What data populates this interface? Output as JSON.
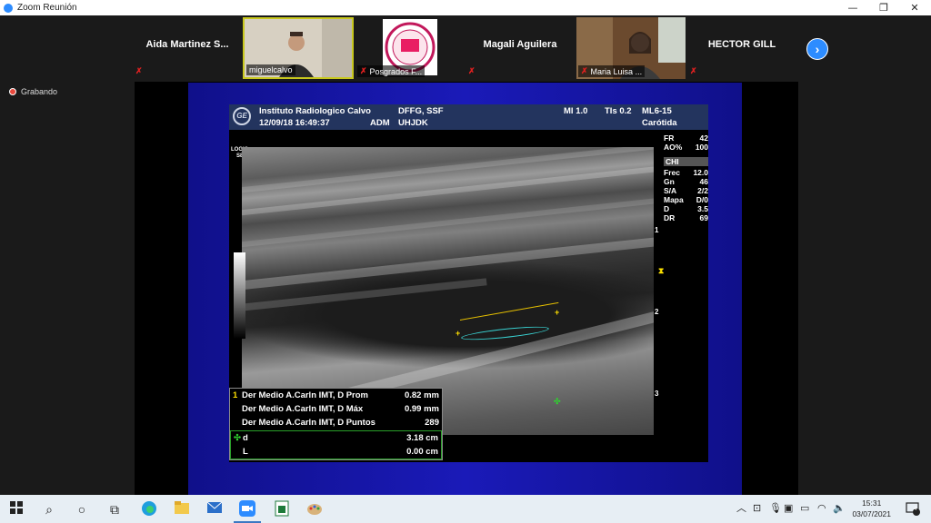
{
  "window": {
    "title": "Zoom Reunión",
    "minimize": "—",
    "restore": "❐",
    "close": "✕"
  },
  "participants": [
    {
      "name": "Aida Martinez S...",
      "type": "name"
    },
    {
      "name": "miguelcalvo",
      "type": "video"
    },
    {
      "name": "Posgrados F...",
      "type": "video"
    },
    {
      "name": "Magali Aguilera",
      "type": "name"
    },
    {
      "name": "Maria Luisa ...",
      "type": "video"
    },
    {
      "name": "HECTOR GILL",
      "type": "name"
    }
  ],
  "next_icon": "chevron-right-icon",
  "recording": {
    "label": "Grabando"
  },
  "ultrasound": {
    "header": {
      "institute": "Instituto Radiologico Calvo",
      "datetime": "12/09/18 16:49:37",
      "operator": "ADM",
      "code1": "DFFG, SSF",
      "code2": "UHJDK",
      "mi": "MI 1.0",
      "tis": "TIs 0.2",
      "probe": "ML6-15",
      "preset": "Carótida"
    },
    "logo": "GE",
    "logiq": [
      "LOGIQ",
      "S8"
    ],
    "side_params_top": [
      {
        "k": "FR",
        "v": "42"
      },
      {
        "k": "AO%",
        "v": "100"
      }
    ],
    "side_mode": "CHI",
    "side_params": [
      {
        "k": "Frec",
        "v": "12.0"
      },
      {
        "k": "Gn",
        "v": "46"
      },
      {
        "k": "S/A",
        "v": "2/2"
      },
      {
        "k": "Mapa",
        "v": "D/0"
      },
      {
        "k": "D",
        "v": "3.5"
      },
      {
        "k": "DR",
        "v": "69"
      }
    ],
    "depth_marks": [
      "1",
      "2",
      "3"
    ],
    "measurements": [
      {
        "idx": "1",
        "label": "Der Medio  A.Carln IMT, D Prom",
        "value": "0.82 mm"
      },
      {
        "idx": "",
        "label": "Der Medio  A.Carln IMT, D Máx",
        "value": "0.99 mm"
      },
      {
        "idx": "",
        "label": "Der Medio  A.Carln IMT, D Puntos",
        "value": "289"
      }
    ],
    "distance": [
      {
        "idx": "✣",
        "label": "d",
        "value": "3.18 cm"
      },
      {
        "idx": "",
        "label": "L",
        "value": "0.00 cm"
      }
    ]
  },
  "taskbar": {
    "time": "15:31",
    "date": "03/07/2021",
    "notifications": "4"
  }
}
